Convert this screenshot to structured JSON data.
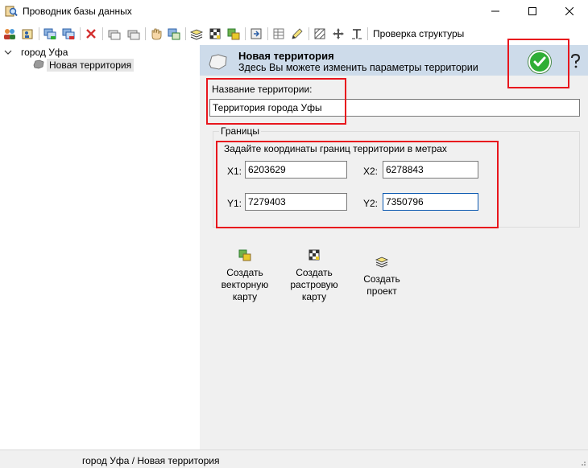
{
  "window": {
    "title": "Проводник базы данных",
    "controls": [
      "minimize",
      "maximize",
      "close"
    ]
  },
  "toolbar": {
    "check_structure_label": "Проверка структуры",
    "icons": [
      "users-icon",
      "user-card-icon",
      "add-layer-icon",
      "remove-layer-icon",
      "delete-icon",
      "stack-icon",
      "stack-alt-icon",
      "hand-icon",
      "map-layers-icon",
      "project-icon",
      "raster-icon",
      "vector-icon",
      "export-icon",
      "table-icon",
      "pencil-icon",
      "grid-icon",
      "move-icon",
      "text-icon"
    ]
  },
  "tree": {
    "root_label": "город Уфа",
    "child_label": "Новая территория"
  },
  "panel": {
    "header_title": "Новая территория",
    "header_subtitle": "Здесь Вы можете изменить параметры территории",
    "name_label": "Название территории:",
    "name_value": "Территория города Уфы",
    "bounds_group_title": "Границы",
    "bounds_hint": "Задайте координаты границ территории в метрах",
    "x1_label": "X1:",
    "x1_value": "6203629",
    "x2_label": "X2:",
    "x2_value": "6278843",
    "y1_label": "Y1:",
    "y1_value": "7279403",
    "y2_label": "Y2:",
    "y2_value": "7350796"
  },
  "actions": {
    "vector_map": [
      "Создать",
      "векторную",
      "карту"
    ],
    "raster_map": [
      "Создать",
      "растровую",
      "карту"
    ],
    "project": [
      "Создать",
      "проект"
    ]
  },
  "status": {
    "path": "город Уфа / Новая территория"
  },
  "colors": {
    "header_bg": "#cddbea",
    "panel_bg": "#f0f0f0",
    "highlight_red": "#e8161d",
    "ok_green": "#2fae35"
  }
}
